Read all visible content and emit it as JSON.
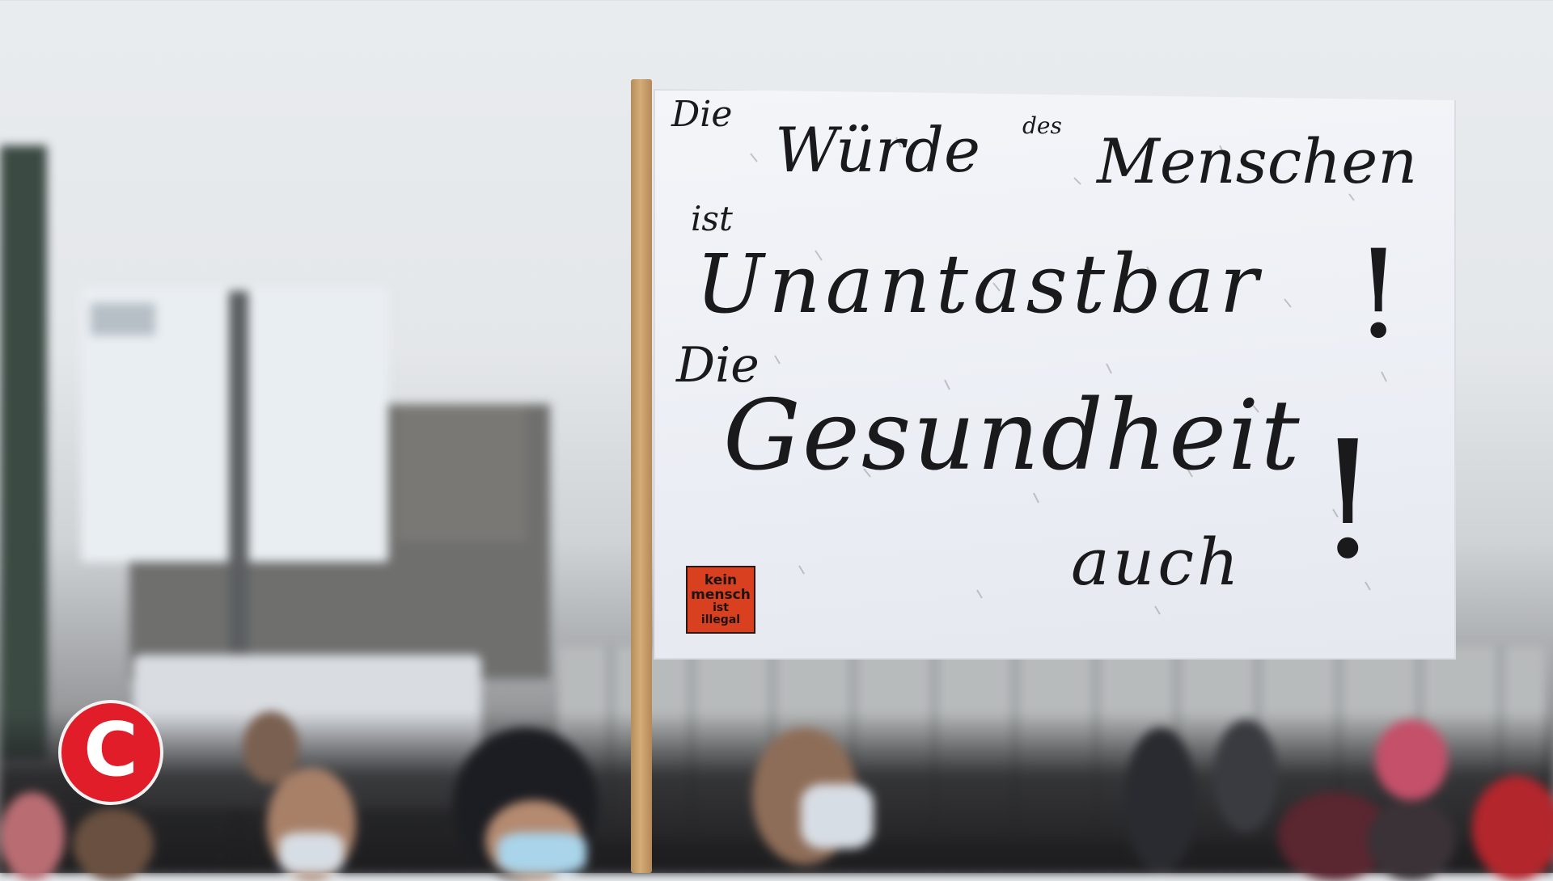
{
  "banner": {
    "lines": [
      "Die",
      "des",
      "Würde",
      "Menschen",
      "ist",
      "Unantastbar",
      "!",
      "Die",
      "Gesundheit",
      "!",
      "auch"
    ],
    "sticker": [
      "kein",
      "mensch",
      "ist",
      "illegal"
    ],
    "ink_color": "#1a1a1c",
    "sticker_color": "#d8401f"
  },
  "logo": {
    "letter": "C",
    "color": "#e11d2a"
  }
}
